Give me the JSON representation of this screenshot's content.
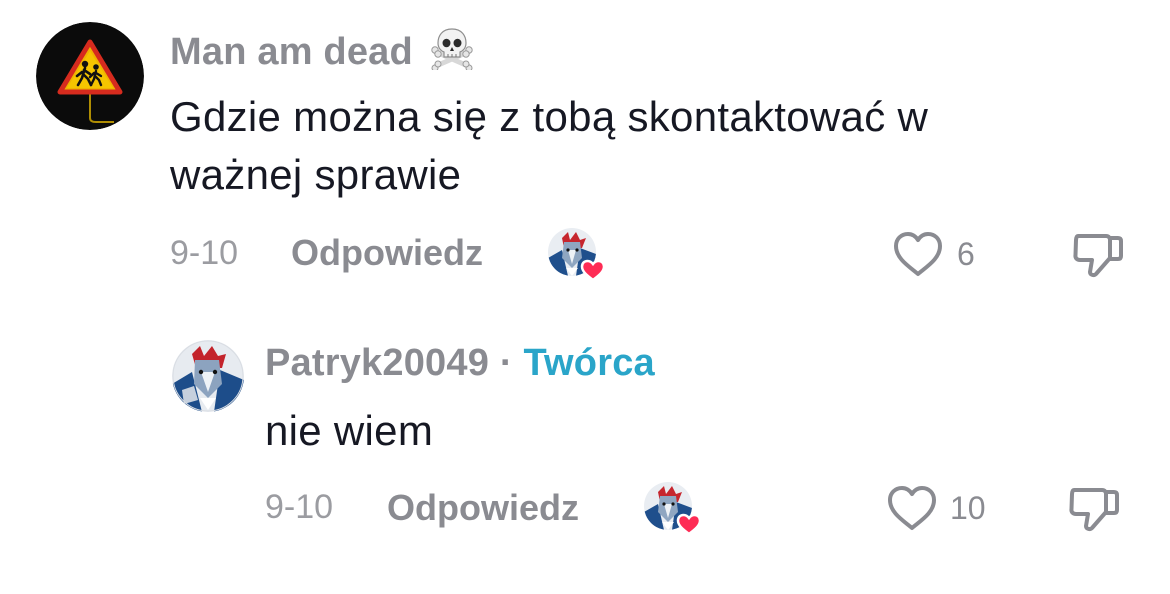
{
  "comments": [
    {
      "username": "Man am dead",
      "username_emoji": "skull-and-crossbones",
      "text_line1": "Gdzie można się z tobą skontaktować w",
      "text_line2": "ważnej sprawie",
      "date": "9-10",
      "reply_label": "Odpowiedz",
      "likes": "6",
      "creator_liked": true
    },
    {
      "username": "Patryk20049",
      "separator": "·",
      "creator_label": "Twórca",
      "text": "nie wiem",
      "date": "9-10",
      "reply_label": "Odpowiedz",
      "likes": "10",
      "creator_liked": true
    }
  ],
  "colors": {
    "username": "#8a8b91",
    "creator_tag": "#2aa5c9",
    "text": "#161823",
    "heart_badge": "#fe2c55"
  }
}
